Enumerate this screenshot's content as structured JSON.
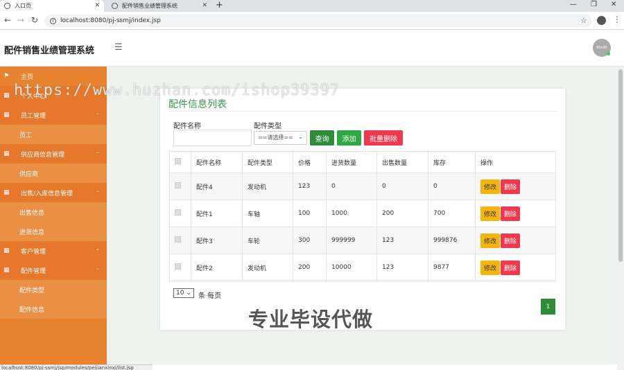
{
  "browser": {
    "tabs": [
      {
        "title": "入口页"
      },
      {
        "title": "配件销售业绩管理系统"
      }
    ],
    "url": "localhost:8080/pj-ssmj/index.jsp",
    "status_url": "localhost:8080/pj-ssmj/jsp/modules/peijianxinxi/list.jsp"
  },
  "header": {
    "brand": "配件销售业绩管理系统",
    "avatar_text": "80x80"
  },
  "sidebar": {
    "items": [
      {
        "label": "主页",
        "kind": "top",
        "icon": "flag-icon"
      },
      {
        "label": "个人中心",
        "kind": "grp",
        "icon": "grid-icon"
      },
      {
        "label": "员工管理",
        "kind": "grp",
        "icon": "grid-icon"
      },
      {
        "label": "员工",
        "kind": "sub"
      },
      {
        "label": "供应商信息管理",
        "kind": "grp",
        "icon": "grid-icon"
      },
      {
        "label": "供应商",
        "kind": "sub"
      },
      {
        "label": "出售/入库信息管理",
        "kind": "grp",
        "icon": "grid-icon"
      },
      {
        "label": "出售信息",
        "kind": "sub"
      },
      {
        "label": "进货信息",
        "kind": "sub"
      },
      {
        "label": "客户管理",
        "kind": "grp",
        "icon": "grid-icon"
      },
      {
        "label": "配件管理",
        "kind": "grp",
        "icon": "grid-icon"
      },
      {
        "label": "配件类型",
        "kind": "sub"
      },
      {
        "label": "配件信息",
        "kind": "sub"
      }
    ]
  },
  "card": {
    "title": "配件信息列表",
    "search": {
      "name_label": "配件名称",
      "name_value": "",
      "type_label": "配件类型",
      "type_selected": "==请选择=="
    },
    "buttons": {
      "query": "查询",
      "add": "添加",
      "batch_delete": "批量删除"
    },
    "table": {
      "headers": [
        "配件名称",
        "配件类型",
        "价格",
        "进货数量",
        "出售数量",
        "库存",
        "操作"
      ],
      "rows": [
        {
          "name": "配件4",
          "type": "发动机",
          "price": "123",
          "in_qty": "0",
          "sold_qty": "0",
          "stock": "0"
        },
        {
          "name": "配件1",
          "type": "车轴",
          "price": "100",
          "in_qty": "1000",
          "sold_qty": "200",
          "stock": "700"
        },
        {
          "name": "配件3",
          "type": "车轮",
          "price": "300",
          "in_qty": "999999",
          "sold_qty": "123",
          "stock": "999876"
        },
        {
          "name": "配件2",
          "type": "发动机",
          "price": "200",
          "in_qty": "10000",
          "sold_qty": "123",
          "stock": "9877"
        }
      ],
      "edit_label": "修改",
      "delete_label": "删除"
    },
    "pager": {
      "page_size": "10",
      "per_page_text": "条 每页",
      "current_page": "1"
    }
  },
  "watermarks": {
    "url": "https://www.huzhan.com/ishop39397",
    "text": "专业毕设代做"
  }
}
